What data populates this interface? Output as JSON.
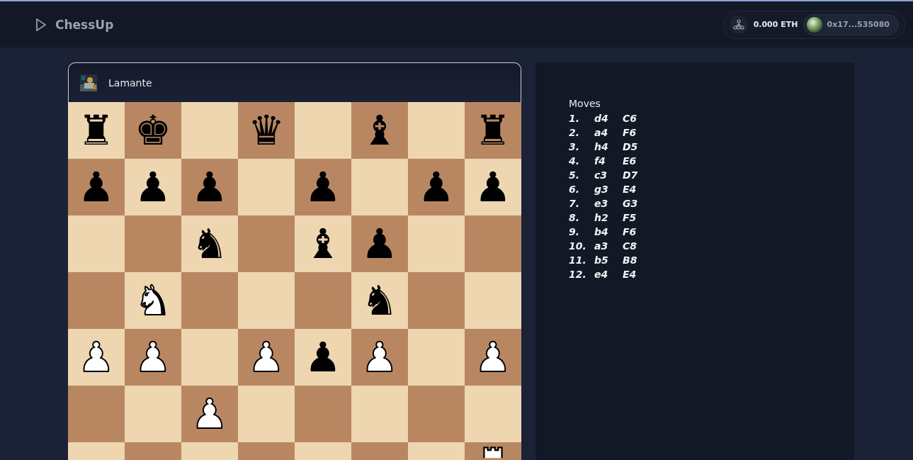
{
  "header": {
    "logo": "ChessUp",
    "balance": "0.000 ETH",
    "address": "0x17...535080"
  },
  "player": {
    "name": "Lamante"
  },
  "board": [
    [
      {
        "kind": "black",
        "piece": "♜"
      },
      {
        "kind": "black",
        "piece": "♚"
      },
      {
        "kind": "empty"
      },
      {
        "kind": "black",
        "piece": "♛"
      },
      {
        "kind": "empty"
      },
      {
        "kind": "black",
        "piece": "♝"
      },
      {
        "kind": "empty"
      },
      {
        "kind": "black",
        "piece": "♜"
      }
    ],
    [
      {
        "kind": "black",
        "piece": "♟"
      },
      {
        "kind": "black",
        "piece": "♟"
      },
      {
        "kind": "black",
        "piece": "♟"
      },
      {
        "kind": "empty"
      },
      {
        "kind": "black",
        "piece": "♟"
      },
      {
        "kind": "empty"
      },
      {
        "kind": "black",
        "piece": "♟"
      },
      {
        "kind": "black",
        "piece": "♟"
      }
    ],
    [
      {
        "kind": "empty"
      },
      {
        "kind": "empty"
      },
      {
        "kind": "black",
        "piece": "♞"
      },
      {
        "kind": "empty"
      },
      {
        "kind": "black",
        "piece": "♝"
      },
      {
        "kind": "black",
        "piece": "♟"
      },
      {
        "kind": "empty"
      },
      {
        "kind": "empty"
      }
    ],
    [
      {
        "kind": "empty"
      },
      {
        "kind": "white",
        "piece": "♞"
      },
      {
        "kind": "empty"
      },
      {
        "kind": "empty"
      },
      {
        "kind": "empty"
      },
      {
        "kind": "black",
        "piece": "♞"
      },
      {
        "kind": "empty"
      },
      {
        "kind": "empty"
      }
    ],
    [
      {
        "kind": "white",
        "piece": "♟"
      },
      {
        "kind": "white",
        "piece": "♟"
      },
      {
        "kind": "empty"
      },
      {
        "kind": "white",
        "piece": "♟"
      },
      {
        "kind": "black",
        "piece": "♟"
      },
      {
        "kind": "white",
        "piece": "♟"
      },
      {
        "kind": "empty"
      },
      {
        "kind": "white",
        "piece": "♟"
      }
    ],
    [
      {
        "kind": "empty"
      },
      {
        "kind": "empty"
      },
      {
        "kind": "white",
        "piece": "♟"
      },
      {
        "kind": "empty"
      },
      {
        "kind": "empty"
      },
      {
        "kind": "empty"
      },
      {
        "kind": "empty"
      },
      {
        "kind": "empty"
      }
    ],
    [
      {
        "kind": "empty"
      },
      {
        "kind": "empty"
      },
      {
        "kind": "empty"
      },
      {
        "kind": "empty"
      },
      {
        "kind": "empty"
      },
      {
        "kind": "empty"
      },
      {
        "kind": "empty"
      },
      {
        "kind": "cut"
      }
    ]
  ],
  "moves_title": "Moves",
  "moves": [
    {
      "number": "1.",
      "white": "d4",
      "black": "C6"
    },
    {
      "number": "2.",
      "white": "a4",
      "black": "F6"
    },
    {
      "number": "3.",
      "white": "h4",
      "black": "D5"
    },
    {
      "number": "4.",
      "white": "f4",
      "black": "E6"
    },
    {
      "number": "5.",
      "white": "c3",
      "black": "D7"
    },
    {
      "number": "6.",
      "white": "g3",
      "black": "E4"
    },
    {
      "number": "7.",
      "white": "e3",
      "black": "G3"
    },
    {
      "number": "8.",
      "white": "h2",
      "black": "F5"
    },
    {
      "number": "9.",
      "white": "b4",
      "black": "F6"
    },
    {
      "number": "10.",
      "white": "a3",
      "black": "C8"
    },
    {
      "number": "11.",
      "white": "b5",
      "black": "B8"
    },
    {
      "number": "12.",
      "white": "e4",
      "black": "E4"
    }
  ]
}
